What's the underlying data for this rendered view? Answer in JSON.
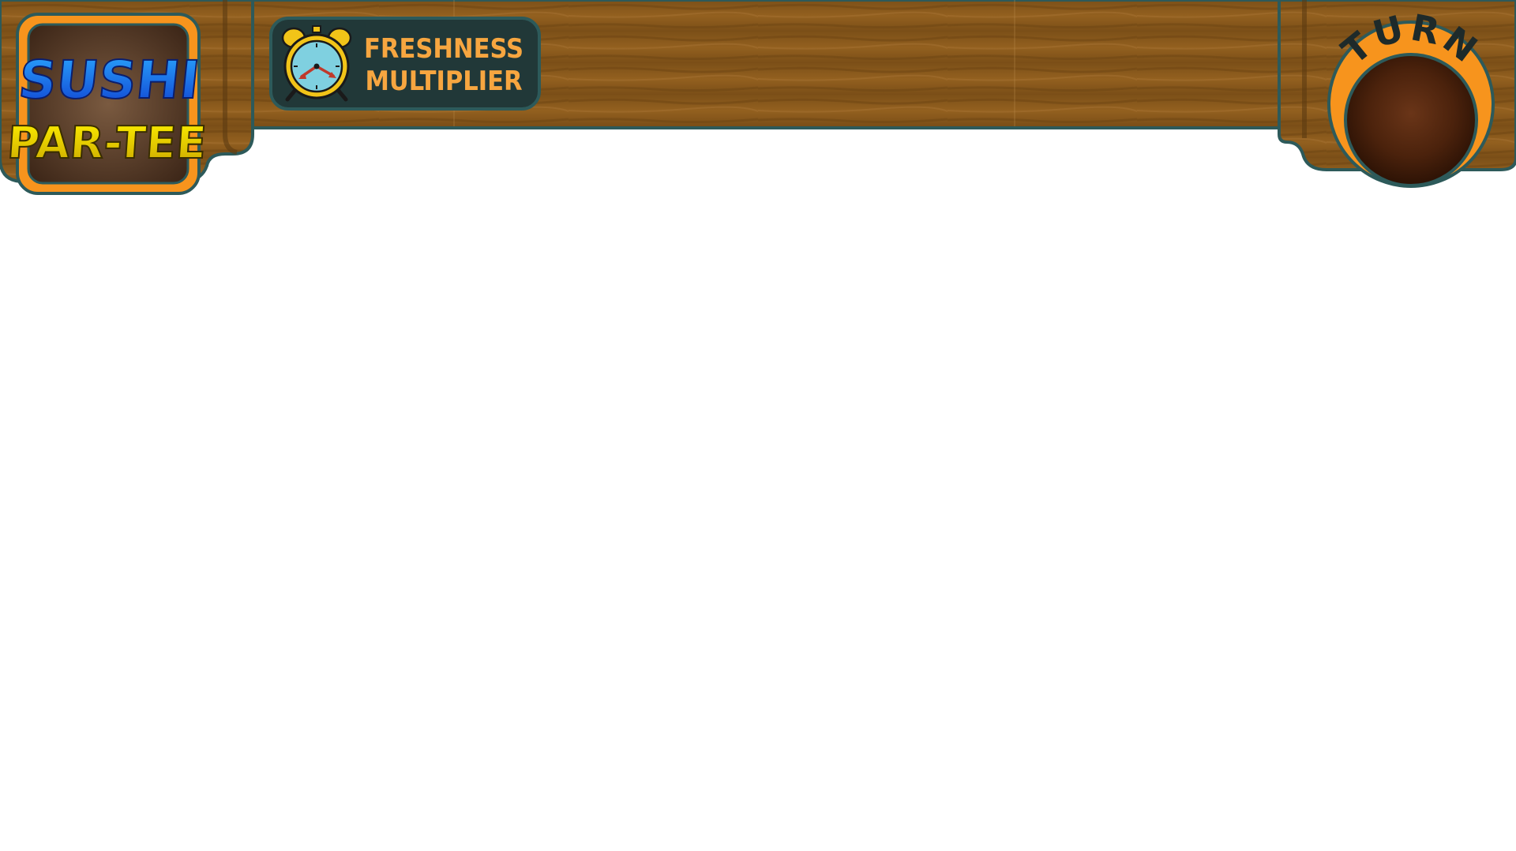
{
  "game": {
    "logo": {
      "line1": "SUSHI",
      "line2": "PAR-TEE"
    },
    "freshness": {
      "label_line1": "FRESHNESS",
      "label_line2": "MULTIPLIER",
      "icon": "alarm-clock-icon"
    },
    "turn": {
      "label": "TURN"
    }
  },
  "colors": {
    "wood": "#8a5a1e",
    "wood_dark": "#6b4314",
    "wood_light": "#a36e28",
    "outline": "#2d5a5a",
    "orange": "#f7941d",
    "badge_bg": "#213838",
    "badge_text": "#f7a640",
    "turn_hole": "#4a220d",
    "logo_blue": "#1976ff",
    "logo_yellow": "#f2e600"
  }
}
